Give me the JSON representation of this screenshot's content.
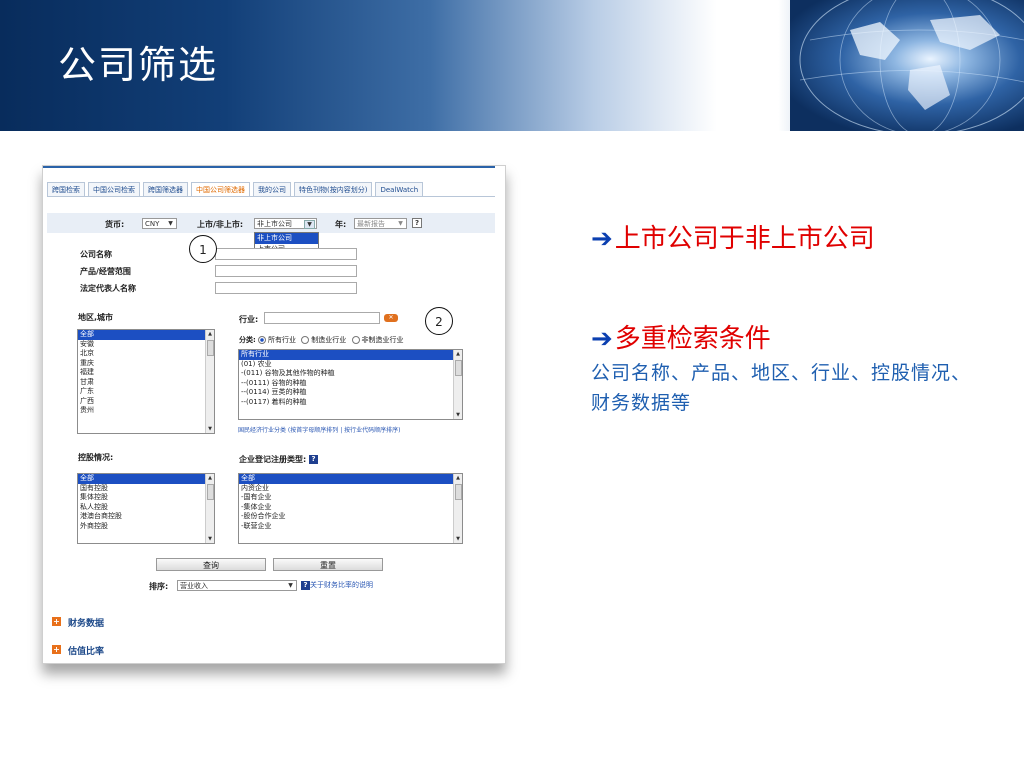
{
  "slide": {
    "title": "公司筛选"
  },
  "tabs": [
    "跨国检索",
    "中国公司检索",
    "跨国筛选器",
    "中国公司筛选器",
    "我的公司",
    "特色刊物(按内容划分)",
    "DealWatch"
  ],
  "filter": {
    "currency_label": "货币:",
    "currency_value": "CNY",
    "listing_label": "上市/非上市:",
    "listing_value": "非上市公司",
    "listing_options": [
      "非上市公司",
      "上市公司"
    ],
    "year_label": "年:",
    "year_value": "最新报告"
  },
  "fields": {
    "company_name": "公司名称",
    "product_scope": "产品/经营范围",
    "legal_rep": "法定代表人名称"
  },
  "region": {
    "label": "地区,城市",
    "items": [
      "全部",
      "安徽",
      "北京",
      "重庆",
      "福建",
      "甘肃",
      "广东",
      "广西",
      "贵州"
    ]
  },
  "industry": {
    "label": "行业:",
    "class_label": "分类:",
    "radio_options": [
      "所有行业",
      "制造业行业",
      "非制造业行业"
    ],
    "items": [
      "所有行业",
      "(01) 农业",
      "-(011) 谷物及其他作物的种植",
      "--(0111) 谷物的种植",
      "--(0114) 豆类的种植",
      "--(0117) 着料的种植"
    ],
    "link_main": "国民经济行业分类",
    "link_sort1": "按首字母顺序排列",
    "link_sep": "|",
    "link_sort2": "按行业代码顺序排序"
  },
  "holding": {
    "label": "控股情况:",
    "items": [
      "全部",
      "国有控股",
      "集体控股",
      "私人控股",
      "港澳台商控股",
      "外商控股"
    ]
  },
  "regtype": {
    "label": "企业登记注册类型:",
    "items": [
      "全部",
      "内资企业",
      "-国有企业",
      "-集体企业",
      "-股份合作企业",
      "-联营企业"
    ]
  },
  "buttons": {
    "search": "查询",
    "reset": "重置"
  },
  "sort": {
    "label": "排序:",
    "value": "营业收入",
    "help_link": "关于财务比率的说明"
  },
  "sections": [
    "财务数据",
    "估值比率"
  ],
  "callouts": [
    "1",
    "2"
  ],
  "notes": {
    "bullet1": "上市公司于非上市公司",
    "bullet2": "多重检索条件",
    "desc": "公司名称、产品、地区、行业、控股情况、财务数据等"
  },
  "colors": {
    "banner_dark": "#082c5c",
    "highlight": "#e00000",
    "text_blue": "#1f5fb0",
    "select_blue": "#1c4fc2"
  }
}
